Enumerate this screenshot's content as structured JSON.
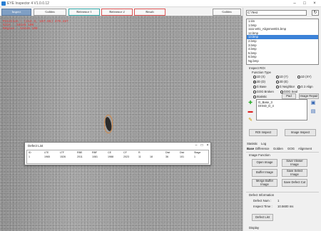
{
  "window": {
    "title": "EYE Inspector 4 V1.0.0.12"
  },
  "tabs": [
    "Inspect",
    "Golden",
    "Reference 1",
    "Reference 2",
    "Result",
    "Golden"
  ],
  "overlay": {
    "lines": [
      "Position : (112.3, 187.65) 470.287",
      "Size : 162x6 100",
      "Region : 154x9 100"
    ]
  },
  "defect_dialog": {
    "title": "Defect List",
    "columns": [
      "ID",
      "LTE",
      "LTF",
      "RBE",
      "RBF",
      "CE",
      "CF",
      "R",
      "Dist",
      "Dist",
      "Stage"
    ],
    "row": [
      "1",
      "1965",
      "1526",
      "2011",
      "1081",
      "1988",
      "2023",
      "11",
      "18",
      "36",
      "101",
      "1"
    ]
  },
  "sidebar": {
    "path": "C:\\Test",
    "files": [
      "1.tim",
      "1.bmp",
      "1111-w01_AlignmentD1.bmp",
      "12.bmp",
      "13.bmp",
      "2.bmp",
      "3.bmp",
      "4.bmp",
      "5.bmp",
      "6.bmp",
      "Ng.bmp"
    ],
    "selected_index": 4,
    "roi_group_label": "Inspect ROI",
    "function_type_label": "Function Type",
    "radios": [
      {
        "label": "1D (X)",
        "checked": false
      },
      {
        "label": "1D (Y)",
        "checked": false
      },
      {
        "label": "1D (XY)",
        "checked": false
      },
      {
        "label": "2D (D)",
        "checked": true
      },
      {
        "label": "2D (E)",
        "checked": false
      },
      {
        "label": "G Base",
        "checked": false
      },
      {
        "label": "G Neighbor",
        "checked": false
      },
      {
        "label": "G 2 Align",
        "checked": false
      },
      {
        "label": "GOG Broken",
        "checked": false
      },
      {
        "label": "GOG Seal",
        "checked": false
      },
      {
        "label": "Statistic",
        "checked": false
      }
    ],
    "pad_button": "Pad",
    "image_repair_button": "Image Repair",
    "roi_list": [
      "G_Base_3",
      "DHSD_D_4"
    ],
    "roi_inspect_button": "ROI Inspect",
    "image_inspect_button": "Image Inspect",
    "content_tabs_row1": [
      "Statistic",
      "Log"
    ],
    "content_tabs_row2": [
      "Base",
      "Difference",
      "Golden",
      "GOG",
      "Alignment"
    ],
    "image_function_label": "Image Function",
    "buttons": {
      "open_image": "Open Image",
      "save_viewer_image": "Save Viewer Image",
      "buffer_image": "Buffer Image",
      "save_select_image": "Save Select Image",
      "merge_buffer_image": "Merge Buffer Image",
      "save_defect_cut": "Save Defect Cut",
      "defect_list": "Defect List"
    },
    "defect_info_label": "Defect Information",
    "defect_num_label": "Defect Num :",
    "defect_num_value": "1",
    "inspect_time_label": "Inspect Time :",
    "inspect_time_value": "10.5600 ms",
    "display_label": "Display"
  }
}
